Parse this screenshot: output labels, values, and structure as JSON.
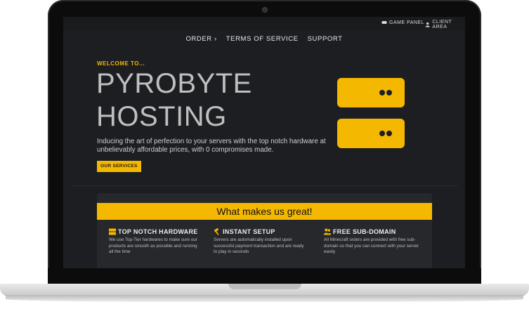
{
  "topbar": {
    "game_panel": "GAME PANEL",
    "client_area": "CLIENT AREA",
    "icons": [
      "gamepad-icon",
      "user-icon"
    ]
  },
  "nav": {
    "items": [
      "ORDER ›",
      "TERMS OF SERVICE",
      "SUPPORT"
    ]
  },
  "hero": {
    "welcome": "WELCOME TO...",
    "title_line1": "PYROBYTE",
    "title_line2": "HOSTING",
    "description": "Inducing the art of perfection to your servers with the top notch hardware at unbelievably affordable prices, with 0 compromises made.",
    "button": "OUR SERVICES"
  },
  "features": {
    "banner": "What makes us great!",
    "items": [
      {
        "icon": "server-icon",
        "title": "TOP NOTCH HARDWARE",
        "text": "We use Top-Tier hardwares to make sure our products are smooth as possible and running all the time"
      },
      {
        "icon": "hammer-icon",
        "title": "INSTANT SETUP",
        "text": "Servers are automatically installed upon successful payment transaction and are ready to play in seconds"
      },
      {
        "icon": "users-icon",
        "title": "FREE SUB-DOMAIN",
        "text": "All Minecraft orders are provided with free sub-domain so that you can connect with your server easily"
      }
    ]
  },
  "colors": {
    "accent": "#f5b800",
    "background": "#1d1e21",
    "card": "#27282c"
  }
}
